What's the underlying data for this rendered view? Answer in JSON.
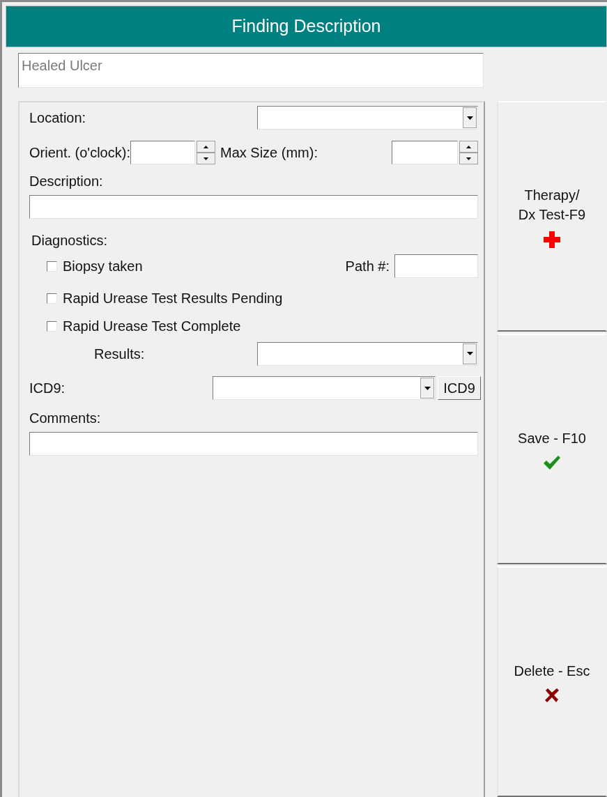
{
  "window": {
    "title": "Finding Description"
  },
  "finding_name": {
    "value": "Healed Ulcer"
  },
  "location": {
    "label": "Location:"
  },
  "orientation": {
    "label": "Orient. (o'clock):"
  },
  "max_size": {
    "label": "Max Size (mm):"
  },
  "description": {
    "label": "Description:"
  },
  "diagnostics": {
    "label": "Diagnostics:",
    "biopsy": {
      "label": "Biopsy taken",
      "checked": false
    },
    "path": {
      "label": "Path #:"
    },
    "urease_pending": {
      "label": "Rapid Urease Test Results Pending",
      "checked": false
    },
    "urease_complete": {
      "label": "Rapid Urease Test Complete",
      "checked": false
    },
    "results": {
      "label": "Results:"
    }
  },
  "icd9": {
    "label": "ICD9:",
    "button": "ICD9"
  },
  "comments": {
    "label": "Comments:"
  },
  "actions": [
    {
      "label": "Therapy/\nDx Test-F9",
      "kind": "plus"
    },
    {
      "label": "Save - F10",
      "kind": "check"
    },
    {
      "label": "Delete - Esc",
      "kind": "cross"
    }
  ]
}
